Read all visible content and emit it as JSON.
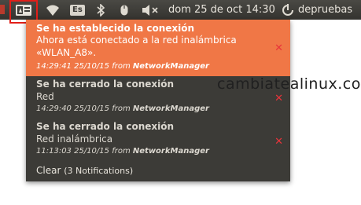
{
  "panel": {
    "keyboard_layout": "Es",
    "clock": "dom 25 de oct 14:30",
    "user": "depruebas",
    "icons": [
      "notification-icon",
      "wifi-icon",
      "bluetooth-icon",
      "mouse-icon",
      "volume-muted-icon",
      "session-icon"
    ]
  },
  "notifications": [
    {
      "title": "Se ha establecido la conexión",
      "body_line1": "Ahora está conectado a la red inalámbrica",
      "body_line2": "«WLAN_A8».",
      "time": "14:29:41 25/10/15",
      "from": "from",
      "app": "NetworkManager"
    },
    {
      "title": "Se ha cerrado la conexión",
      "body_line1": "Red",
      "time": "14:29:40 25/10/15",
      "from": "from",
      "app": "NetworkManager"
    },
    {
      "title": "Se ha cerrado la conexión",
      "body_line1": "Red inalámbrica",
      "time": "11:13:03 25/10/15",
      "from": "from",
      "app": "NetworkManager"
    }
  ],
  "clear": {
    "label": "Clear",
    "count": "(3 Notifications)"
  },
  "watermark": "cambiatealinux.com",
  "colors": {
    "panel": "#3e3d39",
    "menu": "#3c3b37",
    "highlight": "#f07746",
    "close": "#e8343a",
    "annotation": "#e21f19"
  }
}
